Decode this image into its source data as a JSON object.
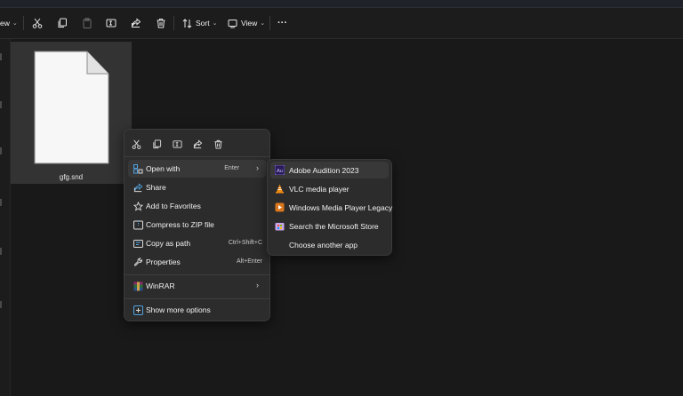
{
  "toolbar": {
    "view_partial": "ew",
    "sort_label": "Sort",
    "view_label": "View",
    "more_label": "···"
  },
  "file": {
    "name": "gfg.snd"
  },
  "context_menu": {
    "items": [
      {
        "label": "Open with",
        "shortcut": "Enter",
        "icon": "open-with-icon",
        "has_submenu": true
      },
      {
        "label": "Share",
        "shortcut": "",
        "icon": "share-icon"
      },
      {
        "label": "Add to Favorites",
        "shortcut": "",
        "icon": "star-icon"
      },
      {
        "label": "Compress to ZIP file",
        "shortcut": "",
        "icon": "zip-icon"
      },
      {
        "label": "Copy as path",
        "shortcut": "Ctrl+Shift+C",
        "icon": "copy-path-icon"
      },
      {
        "label": "Properties",
        "shortcut": "Alt+Enter",
        "icon": "wrench-icon"
      },
      {
        "label": "WinRAR",
        "shortcut": "",
        "icon": "winrar-icon",
        "has_submenu": true
      },
      {
        "label": "Show more options",
        "shortcut": "",
        "icon": "more-options-icon"
      }
    ]
  },
  "open_with_submenu": {
    "items": [
      {
        "label": "Adobe Audition 2023",
        "icon": "adobe-audition-icon",
        "icon_text": "Au"
      },
      {
        "label": "VLC media player",
        "icon": "vlc-icon"
      },
      {
        "label": "Windows Media Player Legacy",
        "icon": "windows-media-player-icon"
      },
      {
        "label": "Search the Microsoft Store",
        "icon": "microsoft-store-icon"
      },
      {
        "label": "Choose another app",
        "icon": ""
      }
    ]
  },
  "colors": {
    "background": "#191919",
    "menu_background": "#2c2c2c",
    "highlight": "#383838",
    "icon_blue": "#4fa3e0",
    "adobe_purple": "#2c1c5a"
  }
}
